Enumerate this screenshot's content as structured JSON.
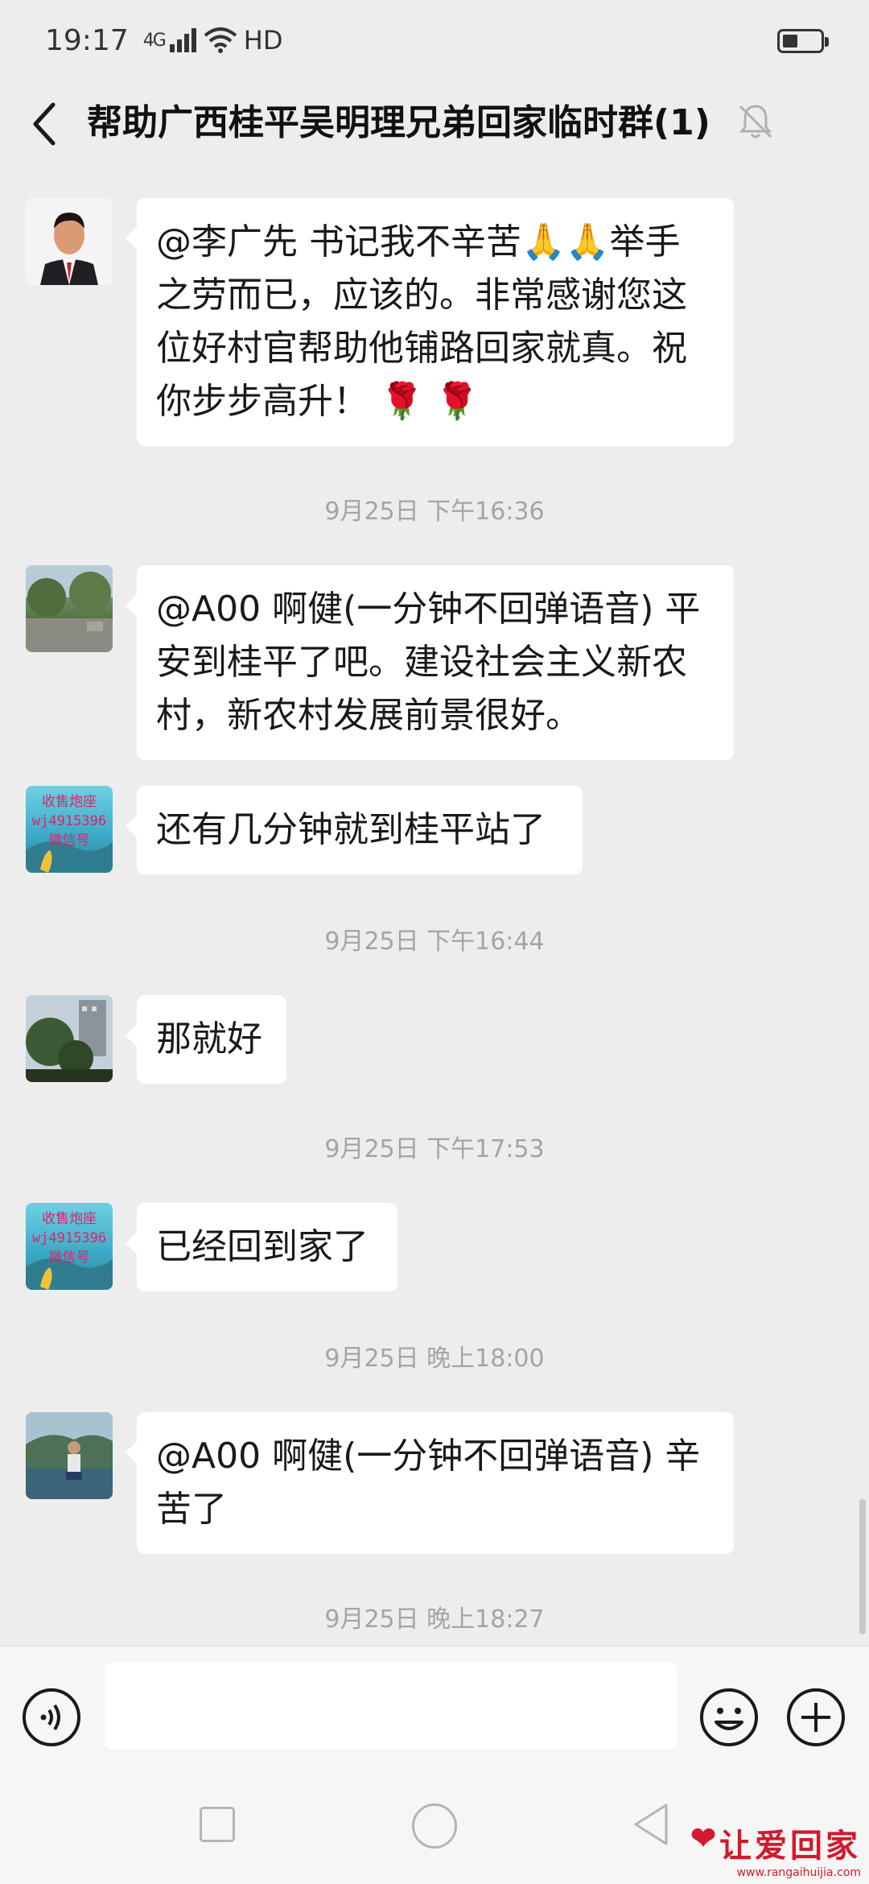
{
  "status_bar": {
    "time": "19:17",
    "network": "4G",
    "hd": "HD"
  },
  "header": {
    "title": "帮助广西桂平吴明理兄弟回家临时群(1)"
  },
  "messages": [
    {
      "text_lines": [
        "@李广先  书记我不辛苦🙏🙏举手",
        "之劳而已，应该的。非常感谢您这",
        "位好村官帮助他铺路回家就真。祝",
        "你步步高升！ 🌹 🌹"
      ]
    },
    {
      "text_lines": [
        "@A00 啊健(一分钟不回弹语音)  平",
        "安到桂平了吧。建设社会主义新农",
        "村，新农村发展前景很好。"
      ]
    },
    {
      "text_lines": [
        "还有几分钟就到桂平站了"
      ],
      "avatar_text": [
        "收售炮座",
        "wj4915396",
        "微信号"
      ]
    },
    {
      "text_lines": [
        "那就好"
      ]
    },
    {
      "text_lines": [
        "已经回到家了"
      ],
      "avatar_text": [
        "收售炮座",
        "wj4915396",
        "微信号"
      ]
    },
    {
      "text_lines": [
        "@A00 啊健(一分钟不回弹语音)  辛",
        "苦了"
      ]
    }
  ],
  "timestamps": [
    "9月25日 下午16:36",
    "9月25日 下午16:44",
    "9月25日 下午17:53",
    "9月25日 晚上18:00",
    "9月25日 晚上18:27"
  ],
  "input": {
    "value": "",
    "placeholder": ""
  },
  "watermark": {
    "brand": "让爱回家",
    "url": "www.rangaihuijia.com"
  },
  "colors": {
    "background": "#ededed",
    "bubble": "#ffffff",
    "timestamp": "#a4a4a4",
    "watermark": "#d2192e"
  },
  "icons": [
    "back-arrow-icon",
    "mute-bell-icon",
    "voice-icon",
    "emoji-icon",
    "plus-icon",
    "nav-recent-icon",
    "nav-home-icon",
    "nav-back-icon"
  ]
}
